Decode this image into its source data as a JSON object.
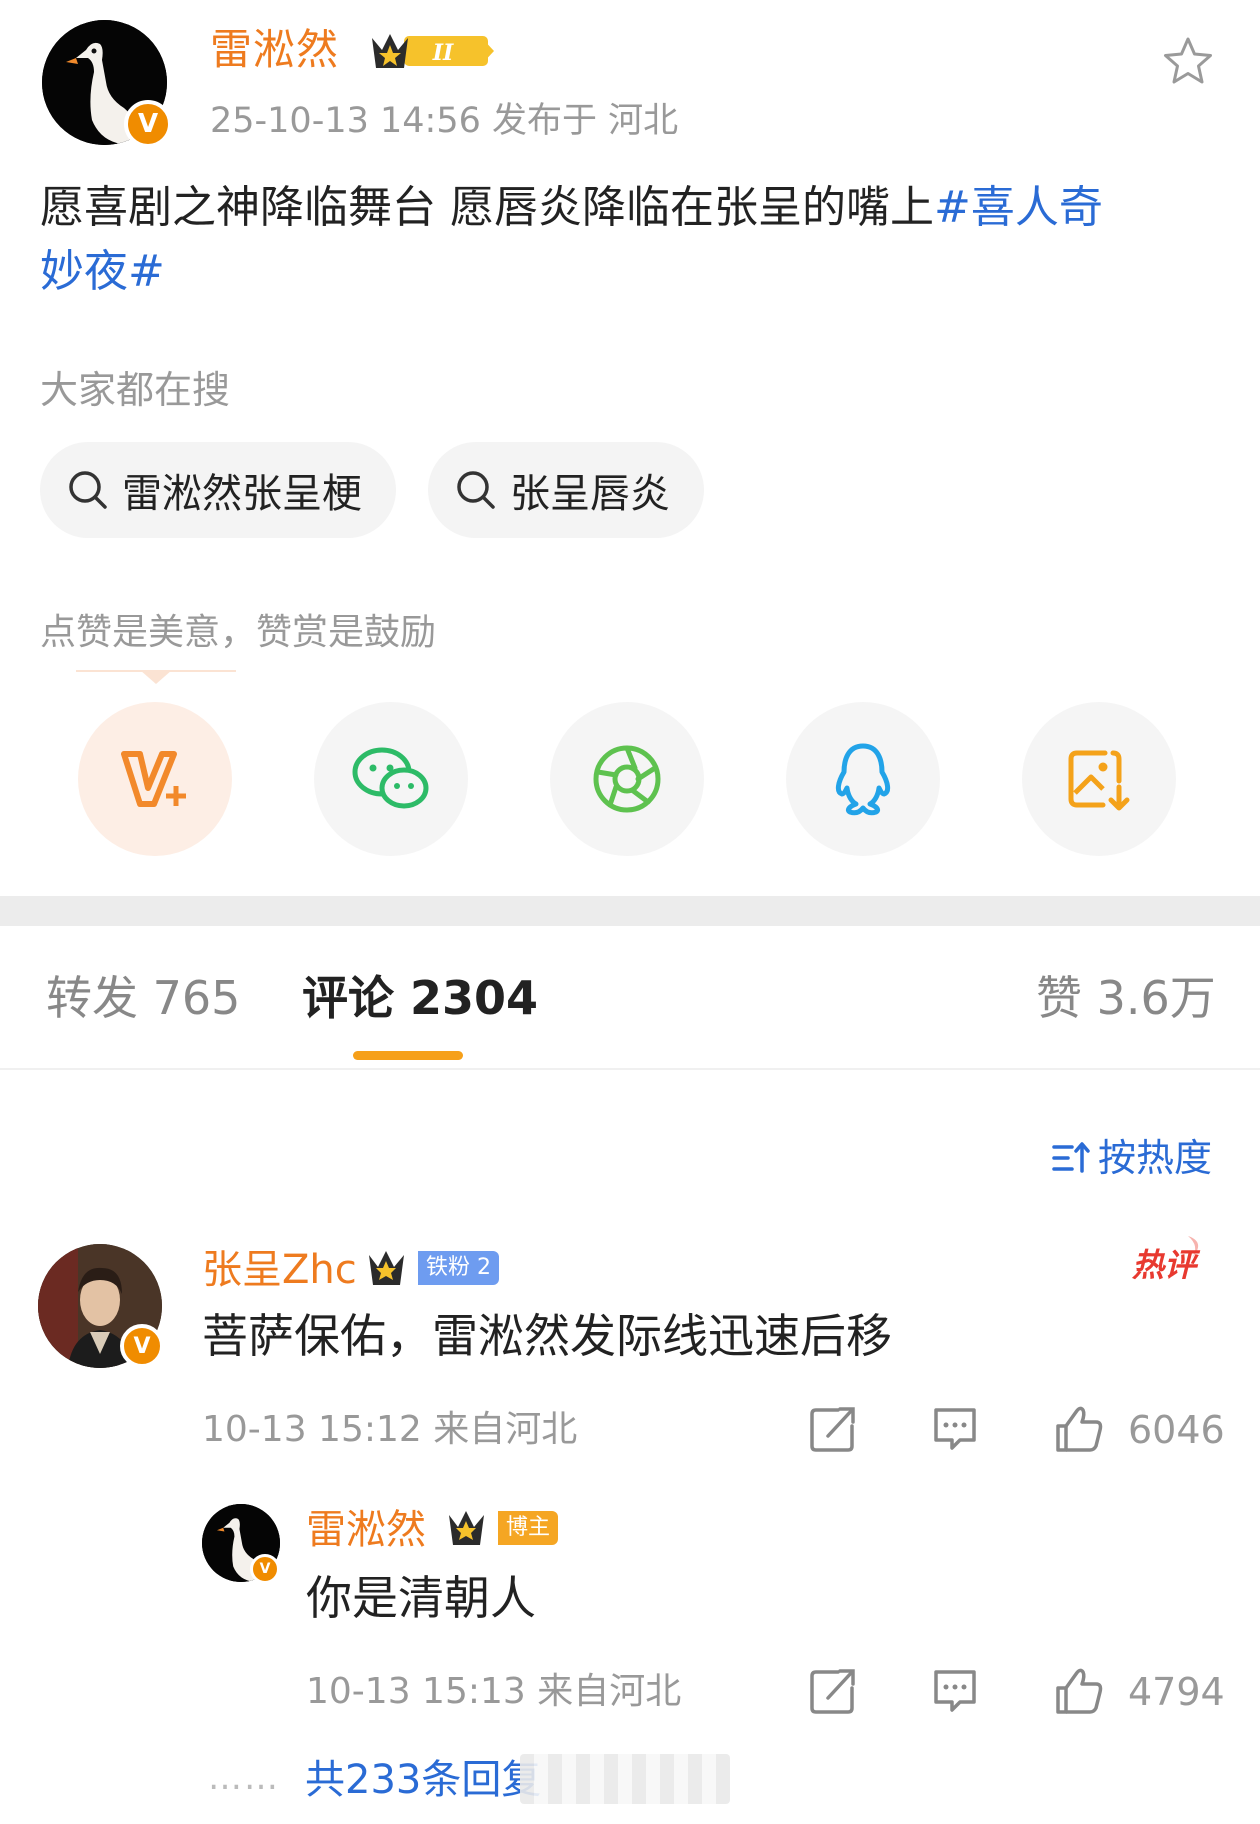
{
  "post": {
    "author": "雷淞然",
    "level_badge": "II",
    "verified_mark": "V",
    "meta": "25-10-13 14:56  发布于 河北",
    "text_main": "愿喜剧之神降临舞台 愿唇炎降临在张呈的嘴上",
    "topic_part1": "#喜人奇",
    "topic_part2": "妙夜#"
  },
  "search": {
    "label": "大家都在搜",
    "chips": [
      "雷淞然张呈梗",
      "张呈唇炎"
    ]
  },
  "reward": {
    "tip": "点赞是美意，赞赏是鼓励",
    "share_icons": [
      "v-plus-icon",
      "wechat-icon",
      "moments-icon",
      "qq-icon",
      "save-image-icon"
    ]
  },
  "tabs": {
    "repost": "转发 765",
    "comments": "评论 2304",
    "likes": "赞 3.6万"
  },
  "sort": {
    "label": "按热度"
  },
  "comments": [
    {
      "name": "张呈Zhc",
      "badge": "铁粉 2",
      "hot": "热评",
      "text": "菩萨保佑，雷淞然发际线迅速后移",
      "meta": "10-13 15:12  来自河北",
      "likes": "6046"
    }
  ],
  "reply": {
    "name": "雷淞然",
    "badge": "博主",
    "text": "你是清朝人",
    "meta": "10-13 15:13  来自河北",
    "likes": "4794",
    "dots": "……",
    "more": "共233条回复"
  },
  "colors": {
    "accent_orange": "#ee7b1f",
    "link_blue": "#2a6bd5",
    "tab_indicator": "#f6a01a"
  }
}
